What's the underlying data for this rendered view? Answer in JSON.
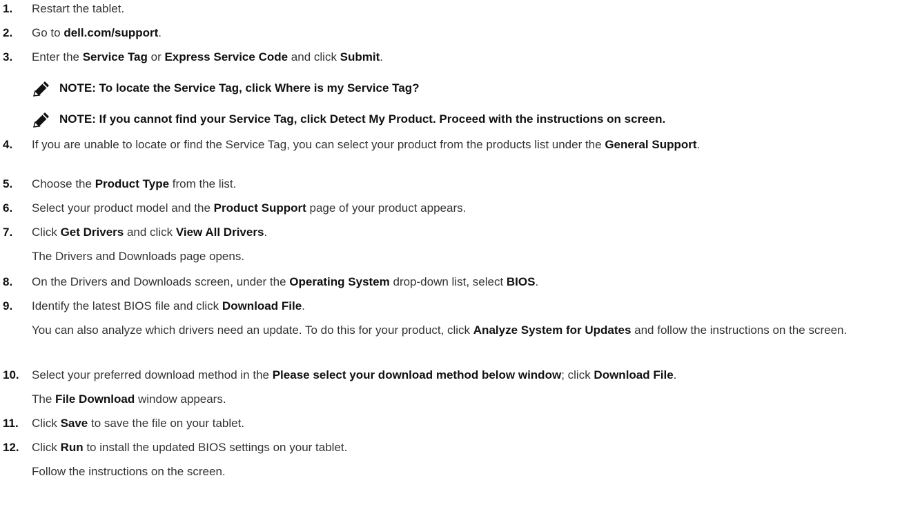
{
  "steps": [
    {
      "num": "1.",
      "parts": [
        {
          "t": "Restart the tablet."
        }
      ]
    },
    {
      "num": "2.",
      "parts": [
        {
          "t": "Go to "
        },
        {
          "t": "dell.com/support",
          "b": true
        },
        {
          "t": "."
        }
      ]
    },
    {
      "num": "3.",
      "parts": [
        {
          "t": "Enter the "
        },
        {
          "t": "Service Tag",
          "b": true
        },
        {
          "t": " or "
        },
        {
          "t": "Express Service Code",
          "b": true
        },
        {
          "t": " and click "
        },
        {
          "t": "Submit",
          "b": true
        },
        {
          "t": "."
        }
      ]
    },
    {
      "num": "4.",
      "parts": [
        {
          "t": "If you are unable to locate or find the Service Tag, you can select your product from the products list under the "
        },
        {
          "t": "General Support",
          "b": true
        },
        {
          "t": "."
        }
      ]
    },
    {
      "num": "5.",
      "parts": [
        {
          "t": "Choose the "
        },
        {
          "t": "Product Type",
          "b": true
        },
        {
          "t": " from the list."
        }
      ]
    },
    {
      "num": "6.",
      "parts": [
        {
          "t": "Select your product model and the "
        },
        {
          "t": "Product Support",
          "b": true
        },
        {
          "t": " page of your product appears."
        }
      ]
    },
    {
      "num": "7.",
      "parts": [
        {
          "t": "Click "
        },
        {
          "t": "Get Drivers",
          "b": true
        },
        {
          "t": " and click "
        },
        {
          "t": "View All Drivers",
          "b": true
        },
        {
          "t": "."
        }
      ]
    },
    {
      "num": "",
      "parts": [
        {
          "t": "The Drivers and Downloads page opens."
        }
      ]
    },
    {
      "num": "8.",
      "parts": [
        {
          "t": "On the Drivers and Downloads screen, under the "
        },
        {
          "t": "Operating System",
          "b": true
        },
        {
          "t": " drop-down list, select "
        },
        {
          "t": "BIOS",
          "b": true
        },
        {
          "t": "."
        }
      ]
    },
    {
      "num": "9.",
      "parts": [
        {
          "t": "Identify the latest BIOS file and click "
        },
        {
          "t": "Download File",
          "b": true
        },
        {
          "t": "."
        }
      ]
    },
    {
      "num": "",
      "parts": [
        {
          "t": "You can also analyze which drivers need an update. To do this for your product, click "
        },
        {
          "t": "Analyze System for Updates",
          "b": true
        },
        {
          "t": " and follow the instructions on the screen."
        }
      ]
    },
    {
      "num": "10.",
      "parts": [
        {
          "t": "Select your preferred download method in the "
        },
        {
          "t": "Please select your download method below window",
          "b": true
        },
        {
          "t": "; click "
        },
        {
          "t": "Download File",
          "b": true
        },
        {
          "t": "."
        }
      ]
    },
    {
      "num": "",
      "parts": [
        {
          "t": "The "
        },
        {
          "t": "File Download",
          "b": true
        },
        {
          "t": " window appears."
        }
      ]
    },
    {
      "num": "11.",
      "parts": [
        {
          "t": "Click "
        },
        {
          "t": "Save",
          "b": true
        },
        {
          "t": " to save the file on your tablet."
        }
      ]
    },
    {
      "num": "12.",
      "parts": [
        {
          "t": "Click "
        },
        {
          "t": "Run",
          "b": true
        },
        {
          "t": " to install the updated BIOS settings on your tablet."
        }
      ]
    },
    {
      "num": "",
      "parts": [
        {
          "t": "Follow the instructions on the screen."
        }
      ]
    }
  ],
  "notes": [
    "NOTE: To locate the Service Tag, click Where is my Service Tag?",
    "NOTE: If you cannot find your Service Tag, click Detect My Product. Proceed with the instructions on screen."
  ],
  "icons": {
    "note_icon": "pencil-note-icon"
  }
}
